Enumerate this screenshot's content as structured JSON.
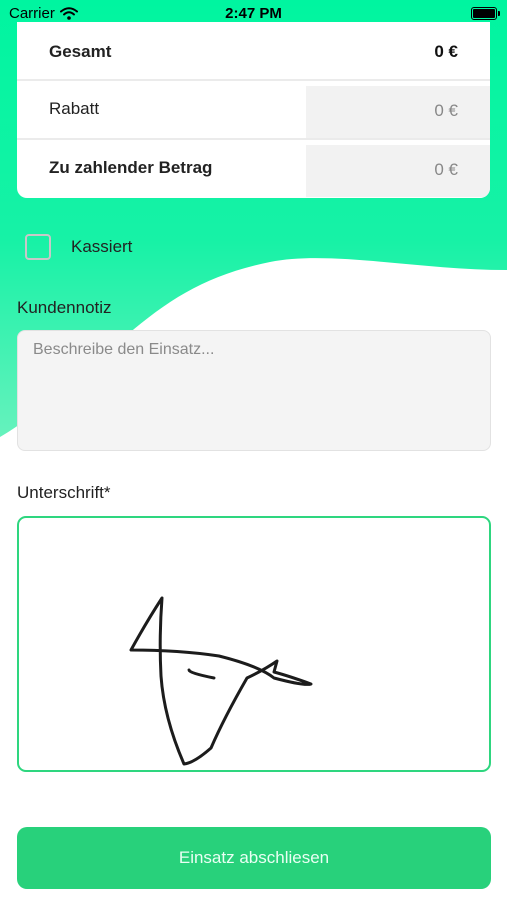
{
  "status_bar": {
    "carrier": "Carrier",
    "time": "2:47 PM"
  },
  "summary": {
    "total_label": "Gesamt",
    "total_value": "0 €",
    "discount_label": "Rabatt",
    "discount_value": "0 €",
    "amount_due_label": "Zu zahlender Betrag",
    "amount_due_value": "0 €"
  },
  "paid_checkbox": {
    "label": "Kassiert",
    "checked": false
  },
  "customer_note": {
    "label": "Kundennotiz",
    "placeholder": "Beschreibe den Einsatz...",
    "value": ""
  },
  "signature": {
    "label": "Unterschrift*"
  },
  "submit_button": {
    "label": "Einsatz abschliesen"
  },
  "colors": {
    "accent": "#28D17B",
    "background_gradient_start": "#00F5A0",
    "background_gradient_end": "#66F2BD"
  }
}
